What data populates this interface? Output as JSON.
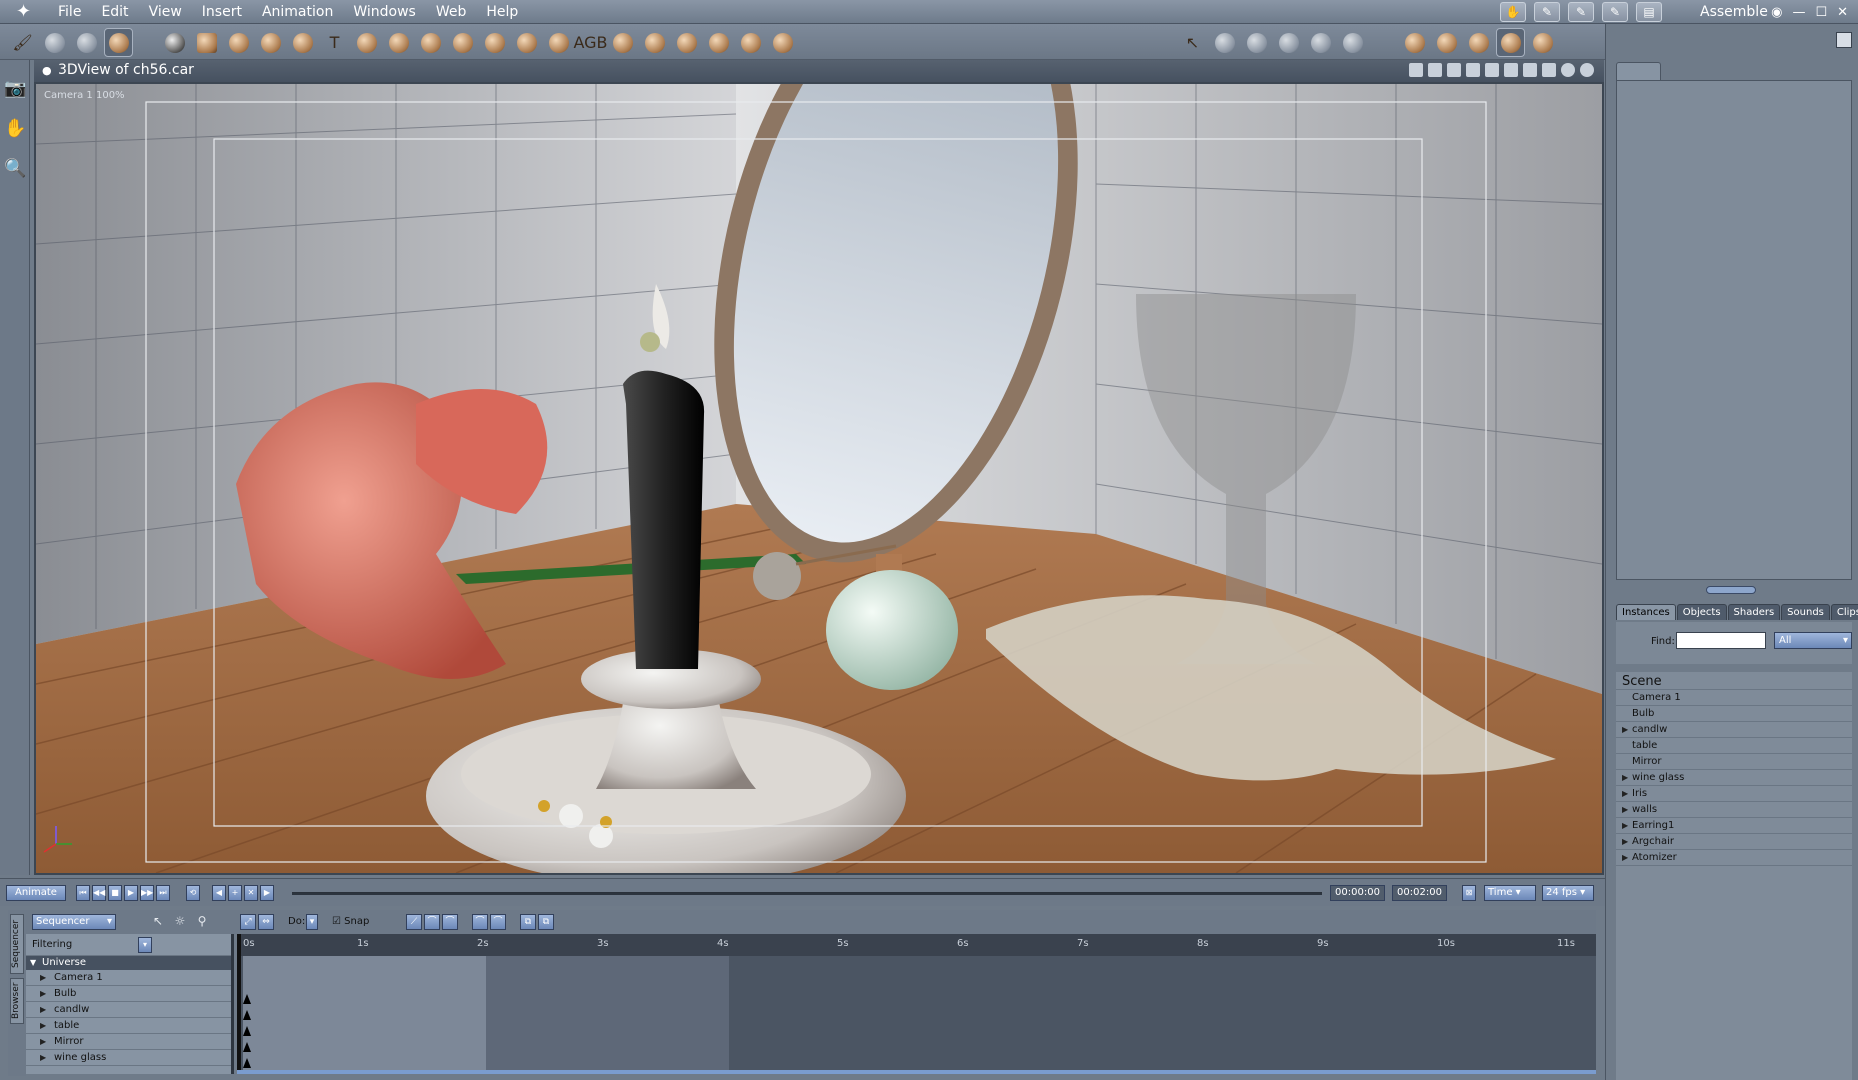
{
  "app": {
    "menus": [
      "File",
      "Edit",
      "View",
      "Insert",
      "Animation",
      "Windows",
      "Web",
      "Help"
    ],
    "room_label": "Assemble"
  },
  "viewport": {
    "title": "3DView of ch56.car",
    "camera_label": "Camera 1 100%"
  },
  "icons": {
    "logo": "carrara-logo-icon",
    "left_palette": [
      "camera-icon",
      "hand-pan-icon",
      "zoom-icon"
    ]
  },
  "timeline": {
    "animate_label": "Animate",
    "current_time": "00:00:00",
    "end_time": "00:02:00",
    "time_mode": "Time",
    "fps": "24 fps"
  },
  "sequencer": {
    "mode": "Sequencer",
    "vtabs": [
      "Sequencer",
      "Browser"
    ],
    "do_label": "Do:",
    "snap_label": "Snap",
    "filtering_label": "Filtering",
    "universe_label": "Universe",
    "rows": [
      {
        "label": "Camera 1",
        "expandable": true
      },
      {
        "label": "Bulb",
        "expandable": true
      },
      {
        "label": "candlw",
        "expandable": true
      },
      {
        "label": "table",
        "expandable": true
      },
      {
        "label": "Mirror",
        "expandable": true
      },
      {
        "label": "wine glass",
        "expandable": true
      }
    ],
    "ticks": [
      "0s",
      "1s",
      "2s",
      "3s",
      "4s",
      "5s",
      "6s",
      "7s",
      "8s",
      "9s",
      "10s",
      "11s"
    ]
  },
  "browser": {
    "tabs": [
      "Instances",
      "Objects",
      "Shaders",
      "Sounds",
      "Clips"
    ],
    "active_tab": "Instances",
    "find_label": "Find:",
    "find_value": "",
    "filter_value": "All",
    "scene_label": "Scene",
    "items": [
      {
        "label": "Camera 1",
        "expandable": false
      },
      {
        "label": "Bulb",
        "expandable": false
      },
      {
        "label": "candlw",
        "expandable": true
      },
      {
        "label": "table",
        "expandable": false
      },
      {
        "label": "Mirror",
        "expandable": false
      },
      {
        "label": "wine glass",
        "expandable": true
      },
      {
        "label": "Iris",
        "expandable": true
      },
      {
        "label": "walls",
        "expandable": true
      },
      {
        "label": "Earring1",
        "expandable": true
      },
      {
        "label": "Argchair",
        "expandable": true
      },
      {
        "label": "Atomizer",
        "expandable": true
      }
    ]
  }
}
